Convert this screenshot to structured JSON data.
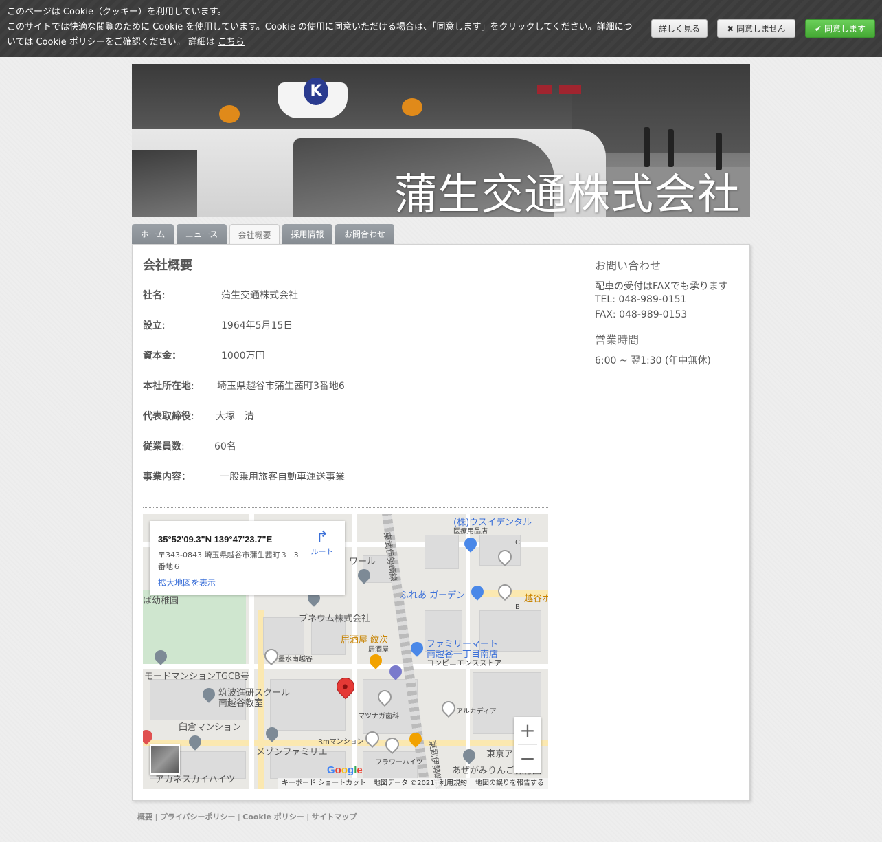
{
  "cookie": {
    "line1": "このページは Cookie（クッキー）を利用しています。",
    "line2": "このサイトでは快適な閲覧のために Cookie を使用しています。Cookie の使用に同意いただける場合は、「同意します」をクリックしてください。詳細については Cookie ポリシーをご確認ください。 詳細は",
    "link": "こちら",
    "more_button": "詳しく見る",
    "decline_button": "同意しません",
    "accept_button": "同意します"
  },
  "header": {
    "site_title": "蒲生交通株式会社",
    "lamp_text": "K"
  },
  "nav": {
    "tabs": [
      {
        "label": "ホーム"
      },
      {
        "label": "ニュース"
      },
      {
        "label": "会社概要"
      },
      {
        "label": "採用情報"
      },
      {
        "label": "お問合わせ"
      }
    ]
  },
  "main": {
    "title": "会社概要",
    "rows": [
      {
        "label": "社名",
        "sep": ":",
        "value": "蒲生交通株式会社"
      },
      {
        "label": "設立",
        "sep": ":",
        "value": "1964年5月15日"
      },
      {
        "label": "資本金：",
        "sep": "",
        "value": "1000万円"
      },
      {
        "label": "本社所在地",
        "sep": ":",
        "value": "埼玉県越谷市蒲生茜町3番地6"
      },
      {
        "label": "代表取締役",
        "sep": ":",
        "value": "大塚　清"
      },
      {
        "label": "従業員数",
        "sep": ":",
        "value": "60名"
      },
      {
        "label": "事業内容",
        "sep": "：",
        "value": "一般乗用旅客自動車運送事業"
      }
    ]
  },
  "map": {
    "coords": "35°52'09.3\"N 139°47'23.7\"E",
    "address": "〒343-0843 埼玉県越谷市蒲生茜町３−3番地６",
    "enlarge_link": "拡大地図を表示",
    "route_label": "ルート",
    "labels": {
      "l1": "(株)ウスイデンタル",
      "l1b": "医療用品店",
      "l2": "ワール",
      "l3": "ふれあ ガーデン",
      "l4": "越谷ホ",
      "l5": "ば幼稚園",
      "l6": "ブネウム株式会社",
      "l7": "居酒屋 紋次",
      "l7b": "居酒屋",
      "l8": "ファミリーマート",
      "l8b": "南越谷一丁目南店",
      "l8c": "コンビニエンスストア",
      "l9": "墨水南越谷",
      "l10": "モードマンションTGCB号",
      "l11": "筑波進研スクール",
      "l11b": "南越谷教室",
      "l12": "マツナガ歯科",
      "l13": "アルカディア",
      "l14": "臼倉マンション",
      "l15": "メゾンファミリエ",
      "l16": "Rmマンション",
      "l17": "フラワーハイツ",
      "l18": "東京ア",
      "l19": "あぜがみりんご保育園",
      "l20": "アカネスカイハイツ",
      "rail1": "東武伊勢崎線",
      "rail2": "東武伊勢崎線",
      "c": "C",
      "b": "B"
    },
    "zoom_in": "+",
    "zoom_out": "−",
    "google": "Google",
    "footer": {
      "shortcuts": "キーボード ショートカット",
      "data": "地図データ ©2021",
      "terms": "利用規約",
      "report": "地図の誤りを報告する"
    }
  },
  "sidebar": {
    "contact_title": "お問い合わせ",
    "fax_note": "配車の受付はFAXでも承ります",
    "tel": " TEL: 048-989-0151",
    "fax": " FAX: 048-989-0153",
    "hours_title": "営業時間",
    "hours": "6:00 ~ 翌1:30 (年中無休)"
  },
  "footer": {
    "links": [
      "概要",
      "プライバシーポリシー",
      "Cookie ポリシー",
      "サイトマップ"
    ],
    "sep": " | "
  }
}
